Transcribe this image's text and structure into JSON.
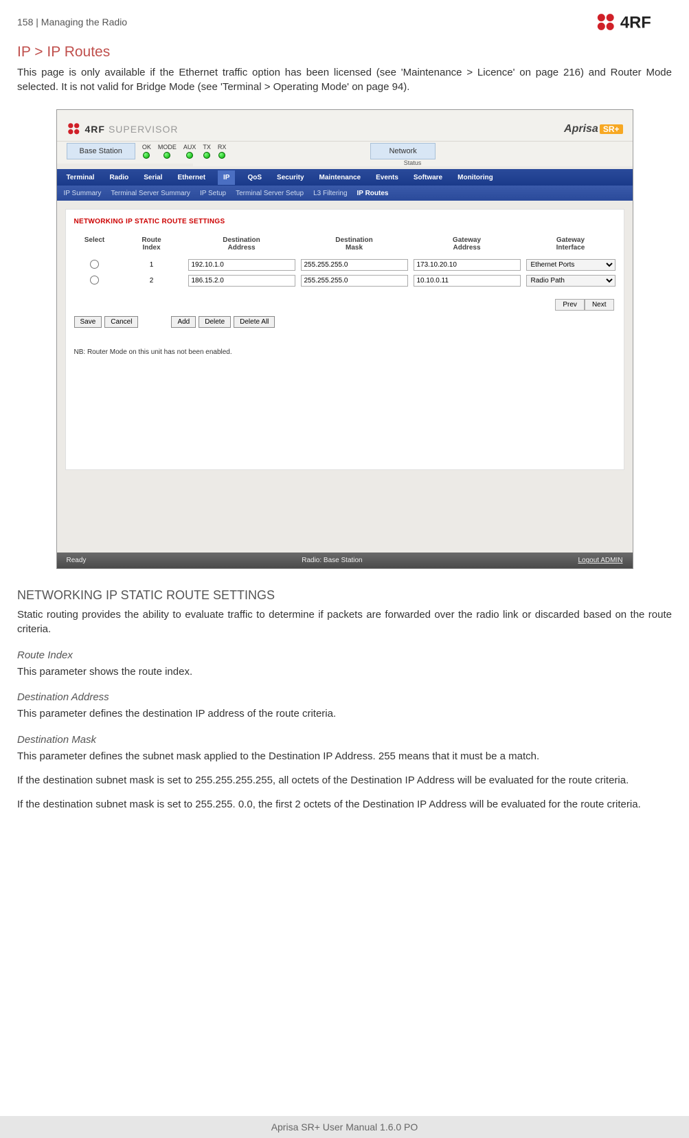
{
  "header": {
    "page_num": "158",
    "section": "Managing the Radio",
    "brand": "4RF"
  },
  "doc": {
    "h1": "IP > IP Routes",
    "intro": "This page is only available if the Ethernet traffic option has been licensed (see 'Maintenance > Licence' on page 216) and Router Mode selected. It is not valid for Bridge Mode (see 'Terminal > Operating Mode' on page 94).",
    "h2": "NETWORKING IP STATIC ROUTE SETTINGS",
    "p2": "Static routing provides the ability to evaluate traffic to determine if packets are forwarded over the radio link or discarded based on the route criteria.",
    "route_index_h": "Route Index",
    "route_index_p": "This parameter shows the route index.",
    "dest_addr_h": "Destination Address",
    "dest_addr_p": "This parameter defines the destination IP address of the route criteria.",
    "dest_mask_h": "Destination Mask",
    "dest_mask_p1": "This parameter defines the subnet mask applied to the Destination IP Address. 255 means that it must be a match.",
    "dest_mask_p2": "If the destination subnet mask is set to 255.255.255.255, all octets of the Destination IP Address will be evaluated for the route criteria.",
    "dest_mask_p3": "If the destination subnet mask is set to 255.255. 0.0, the first 2 octets of the Destination IP Address will be evaluated for the route criteria."
  },
  "supervisor": {
    "logo_text": "SUPERVISOR",
    "aprisa": "Aprisa",
    "sr": "SR+",
    "base_station": "Base Station",
    "leds": [
      "OK",
      "MODE",
      "AUX",
      "TX",
      "RX"
    ],
    "status_label": "Status",
    "network": "Network",
    "menu": [
      "Terminal",
      "Radio",
      "Serial",
      "Ethernet",
      "IP",
      "QoS",
      "Security",
      "Maintenance",
      "Events",
      "Software",
      "Monitoring"
    ],
    "menu_active": "IP",
    "submenu": [
      "IP Summary",
      "Terminal Server Summary",
      "IP Setup",
      "Terminal Server Setup",
      "L3 Filtering",
      "IP Routes"
    ],
    "submenu_active": "IP Routes",
    "panel_title": "NETWORKING IP STATIC ROUTE SETTINGS",
    "cols": {
      "select": "Select",
      "index": "Route\nIndex",
      "dest_addr": "Destination\nAddress",
      "dest_mask": "Destination\nMask",
      "gw_addr": "Gateway\nAddress",
      "gw_if": "Gateway\nInterface"
    },
    "rows": [
      {
        "index": "1",
        "dest": "192.10.1.0",
        "mask": "255.255.255.0",
        "gw": "173.10.20.10",
        "if": "Ethernet Ports"
      },
      {
        "index": "2",
        "dest": "186.15.2.0",
        "mask": "255.255.255.0",
        "gw": "10.10.0.11",
        "if": "Radio Path"
      }
    ],
    "buttons": {
      "save": "Save",
      "cancel": "Cancel",
      "add": "Add",
      "delete": "Delete",
      "delete_all": "Delete All",
      "prev": "Prev",
      "next": "Next"
    },
    "note": "NB: Router Mode on this unit has not been enabled.",
    "footer": {
      "ready": "Ready",
      "radio": "Radio: Base Station",
      "logout": "Logout ADMIN"
    }
  },
  "footer": "Aprisa SR+ User Manual 1.6.0 PO"
}
